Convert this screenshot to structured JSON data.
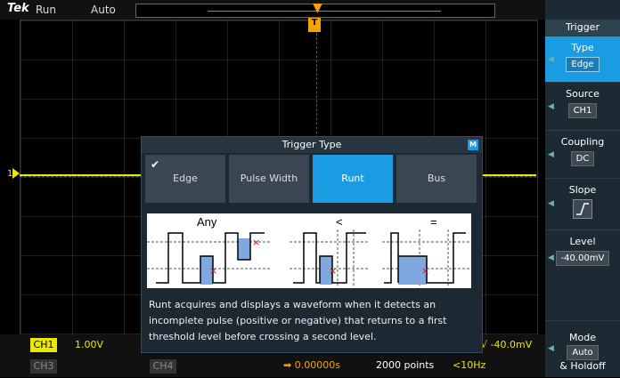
{
  "topbar": {
    "brand": "Tek",
    "run_state": "Run",
    "acq_mode": "Auto",
    "help_icon": "help-icon"
  },
  "side_menu": {
    "header": "Trigger",
    "items": [
      {
        "label": "Type",
        "value": "Edge"
      },
      {
        "label": "Source",
        "value": "CH1"
      },
      {
        "label": "Coupling",
        "value": "DC"
      },
      {
        "label": "Slope",
        "value": ""
      },
      {
        "label": "Level",
        "value": "-40.00mV"
      },
      {
        "label": "Mode",
        "value": "Auto",
        "sub": "& Holdoff"
      }
    ]
  },
  "dialog": {
    "title": "Trigger Type",
    "badge": "M",
    "tabs": [
      "Edge",
      "Pulse Width",
      "Runt",
      "Bus"
    ],
    "selected_tab": "Runt",
    "illustration_labels": [
      "Any",
      "<",
      "="
    ],
    "description": "Runt acquires and displays a waveform when it detects an incomplete pulse (positive or negative) that returns to a first threshold level before crossing a second level."
  },
  "bottombar": {
    "ch1": "CH1",
    "ch1_scale": "1.00V",
    "ch3": "CH3",
    "ch4": "CH4",
    "horizontal_position": "0.00000s",
    "record_points": "2000 points",
    "trigger_freq": "<10Hz",
    "trigger_level": "-40.0mV"
  },
  "colors": {
    "ch1": "#e8e800",
    "accent": "#1a9ce3",
    "trigger": "#f4a300"
  }
}
